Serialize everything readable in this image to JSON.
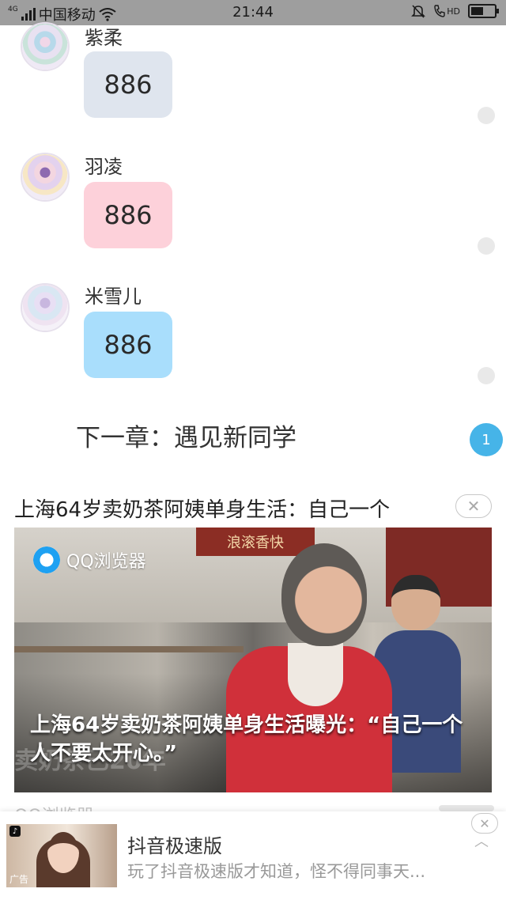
{
  "status_bar": {
    "network": "4G",
    "carrier": "中国移动",
    "time": "21:44",
    "hd_label": "HD",
    "battery_level": 0.55
  },
  "messages": [
    {
      "sender": "紫柔",
      "text": "886",
      "bubble_color": "#dfe5ee",
      "avatar": "purple-anime-avatar"
    },
    {
      "sender": "羽凌",
      "text": "886",
      "bubble_color": "#fdd1da",
      "avatar": "violet-anime-avatar"
    },
    {
      "sender": "米雪儿",
      "text": "886",
      "bubble_color": "#a9defc",
      "avatar": "lilac-anime-avatar"
    }
  ],
  "next_chapter": "下一章：遇见新同学",
  "unread_badge": "1",
  "news_ad": {
    "title": "上海64岁卖奶茶阿姨单身生活：自己一个",
    "brand": "QQ浏览器",
    "shop_sign": "浪滚香快",
    "caption": "上海64岁卖奶茶阿姨单身生活曝光：“自己一个人不要太开心。”",
    "watermark": "卖奶茶已20年",
    "source_peek": "QQ浏览器",
    "close_symbol": "✕"
  },
  "banner_ad": {
    "title": "抖音极速版",
    "description": "玩了抖音极速版才知道，怪不得同事天...",
    "ad_tag": "广告",
    "close_symbol": "✕",
    "collapse_symbol": "︿"
  },
  "colors": {
    "status_bar": "#9e9e9e",
    "badge": "#46b4e8"
  }
}
